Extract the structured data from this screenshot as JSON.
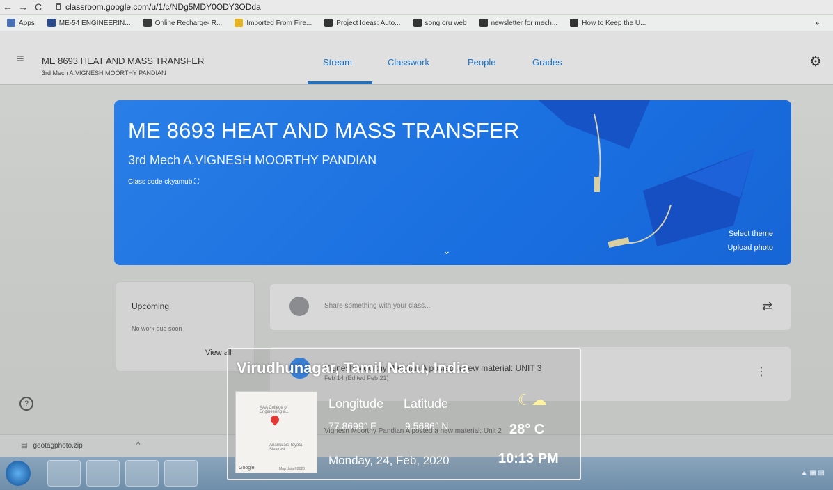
{
  "browser": {
    "url": "classroom.google.com/u/1/c/NDg5MDY0ODY3ODda",
    "bookmarks": [
      {
        "label": "Apps",
        "color": "#4a6fb5"
      },
      {
        "label": "ME-54 ENGINEERIN...",
        "color": "#2b4c8a"
      },
      {
        "label": "Online Recharge- R...",
        "color": "#3a3a3a"
      },
      {
        "label": "Imported From Fire...",
        "color": "#e6b422"
      },
      {
        "label": "Project Ideas: Auto...",
        "color": "#333333"
      },
      {
        "label": "song oru web",
        "color": "#333333"
      },
      {
        "label": "newsletter for mech...",
        "color": "#333333"
      },
      {
        "label": "How to Keep the U...",
        "color": "#333333"
      }
    ],
    "more": "»"
  },
  "header": {
    "course_title": "ME 8693 HEAT AND MASS TRANSFER",
    "course_sub": "3rd Mech A.VIGNESH MOORTHY PANDIAN",
    "tabs": [
      "Stream",
      "Classwork",
      "People",
      "Grades"
    ],
    "active_tab": "Stream"
  },
  "banner": {
    "title": "ME 8693 HEAT AND MASS TRANSFER",
    "subtitle": "3rd Mech A.VIGNESH MOORTHY PANDIAN",
    "class_code": "Class code  ckyamub",
    "select_theme": "Select theme",
    "upload_photo": "Upload photo",
    "color": "#1a6fe0"
  },
  "upcoming": {
    "title": "Upcoming",
    "empty": "No work due soon",
    "view_all": "View all"
  },
  "share": {
    "placeholder": "Share something with your class..."
  },
  "posts": [
    {
      "text": "Vignesh Moorthy Pandian A posted a new material: UNIT 3",
      "date": "Feb 14 (Edited Feb 21)"
    },
    {
      "text": "Vignesh Moorthy Pandian A posted a new material: Unit 2"
    }
  ],
  "downloads": {
    "file": "geotagphoto.zip"
  },
  "geotag": {
    "place": "Virudhunagar, Tamil Nadu, India",
    "longitude_label": "Longitude",
    "latitude_label": "Latitude",
    "longitude": "77.8699° E",
    "latitude": "9.5686° N",
    "temperature": "28° C",
    "date": "Monday, 24, Feb, 2020",
    "time": "10:13 PM",
    "map_labels": {
      "college": "AAA College of Engineering &...",
      "nearby": "Anamalais Toyota, Sivakasi",
      "brand": "Google",
      "credit": "Map data ©2020"
    }
  }
}
